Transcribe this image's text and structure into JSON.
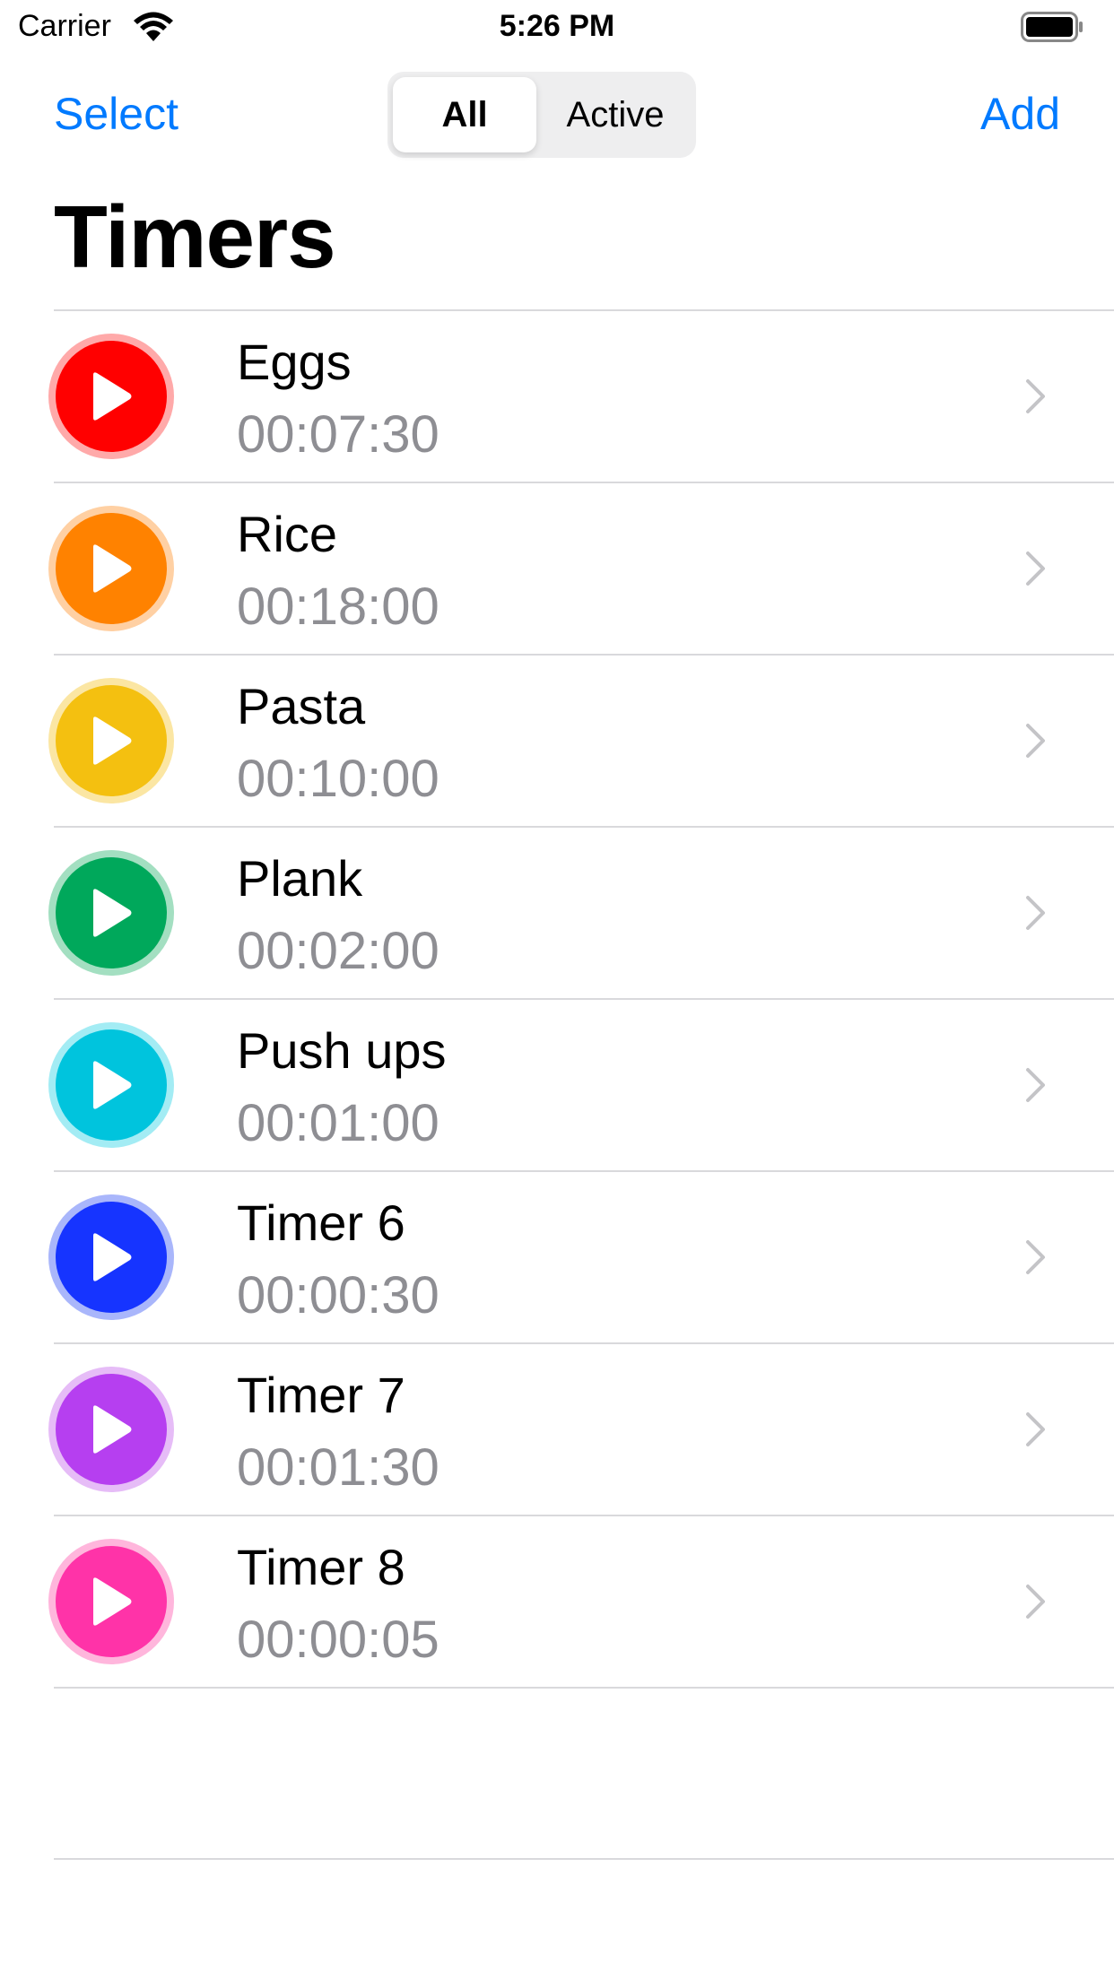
{
  "status_bar": {
    "carrier": "Carrier",
    "time": "5:26 PM"
  },
  "nav": {
    "select_label": "Select",
    "add_label": "Add",
    "segments": [
      {
        "label": "All",
        "selected": true
      },
      {
        "label": "Active",
        "selected": false
      }
    ],
    "accent_color": "#007aff"
  },
  "title": "Timers",
  "timers": [
    {
      "name": "Eggs",
      "duration": "00:07:30",
      "color": "#ff0000",
      "ring": "#ffa9a9"
    },
    {
      "name": "Rice",
      "duration": "00:18:00",
      "color": "#ff8200",
      "ring": "#ffd0a3"
    },
    {
      "name": "Pasta",
      "duration": "00:10:00",
      "color": "#f4c010",
      "ring": "#fbe6a3"
    },
    {
      "name": "Plank",
      "duration": "00:02:00",
      "color": "#00a85b",
      "ring": "#a3dfc1"
    },
    {
      "name": "Push ups",
      "duration": "00:01:00",
      "color": "#00c4dd",
      "ring": "#a3ecf4"
    },
    {
      "name": "Timer 6",
      "duration": "00:00:30",
      "color": "#1634ff",
      "ring": "#a9b6fb"
    },
    {
      "name": "Timer 7",
      "duration": "00:01:30",
      "color": "#b63ff0",
      "ring": "#e6bcf7"
    },
    {
      "name": "Timer 8",
      "duration": "00:00:05",
      "color": "#ff33a8",
      "ring": "#ffb6dc"
    }
  ],
  "icons": {
    "play": "play-icon",
    "chevron": "chevron-right-icon",
    "wifi": "wifi-icon",
    "battery": "battery-icon"
  }
}
